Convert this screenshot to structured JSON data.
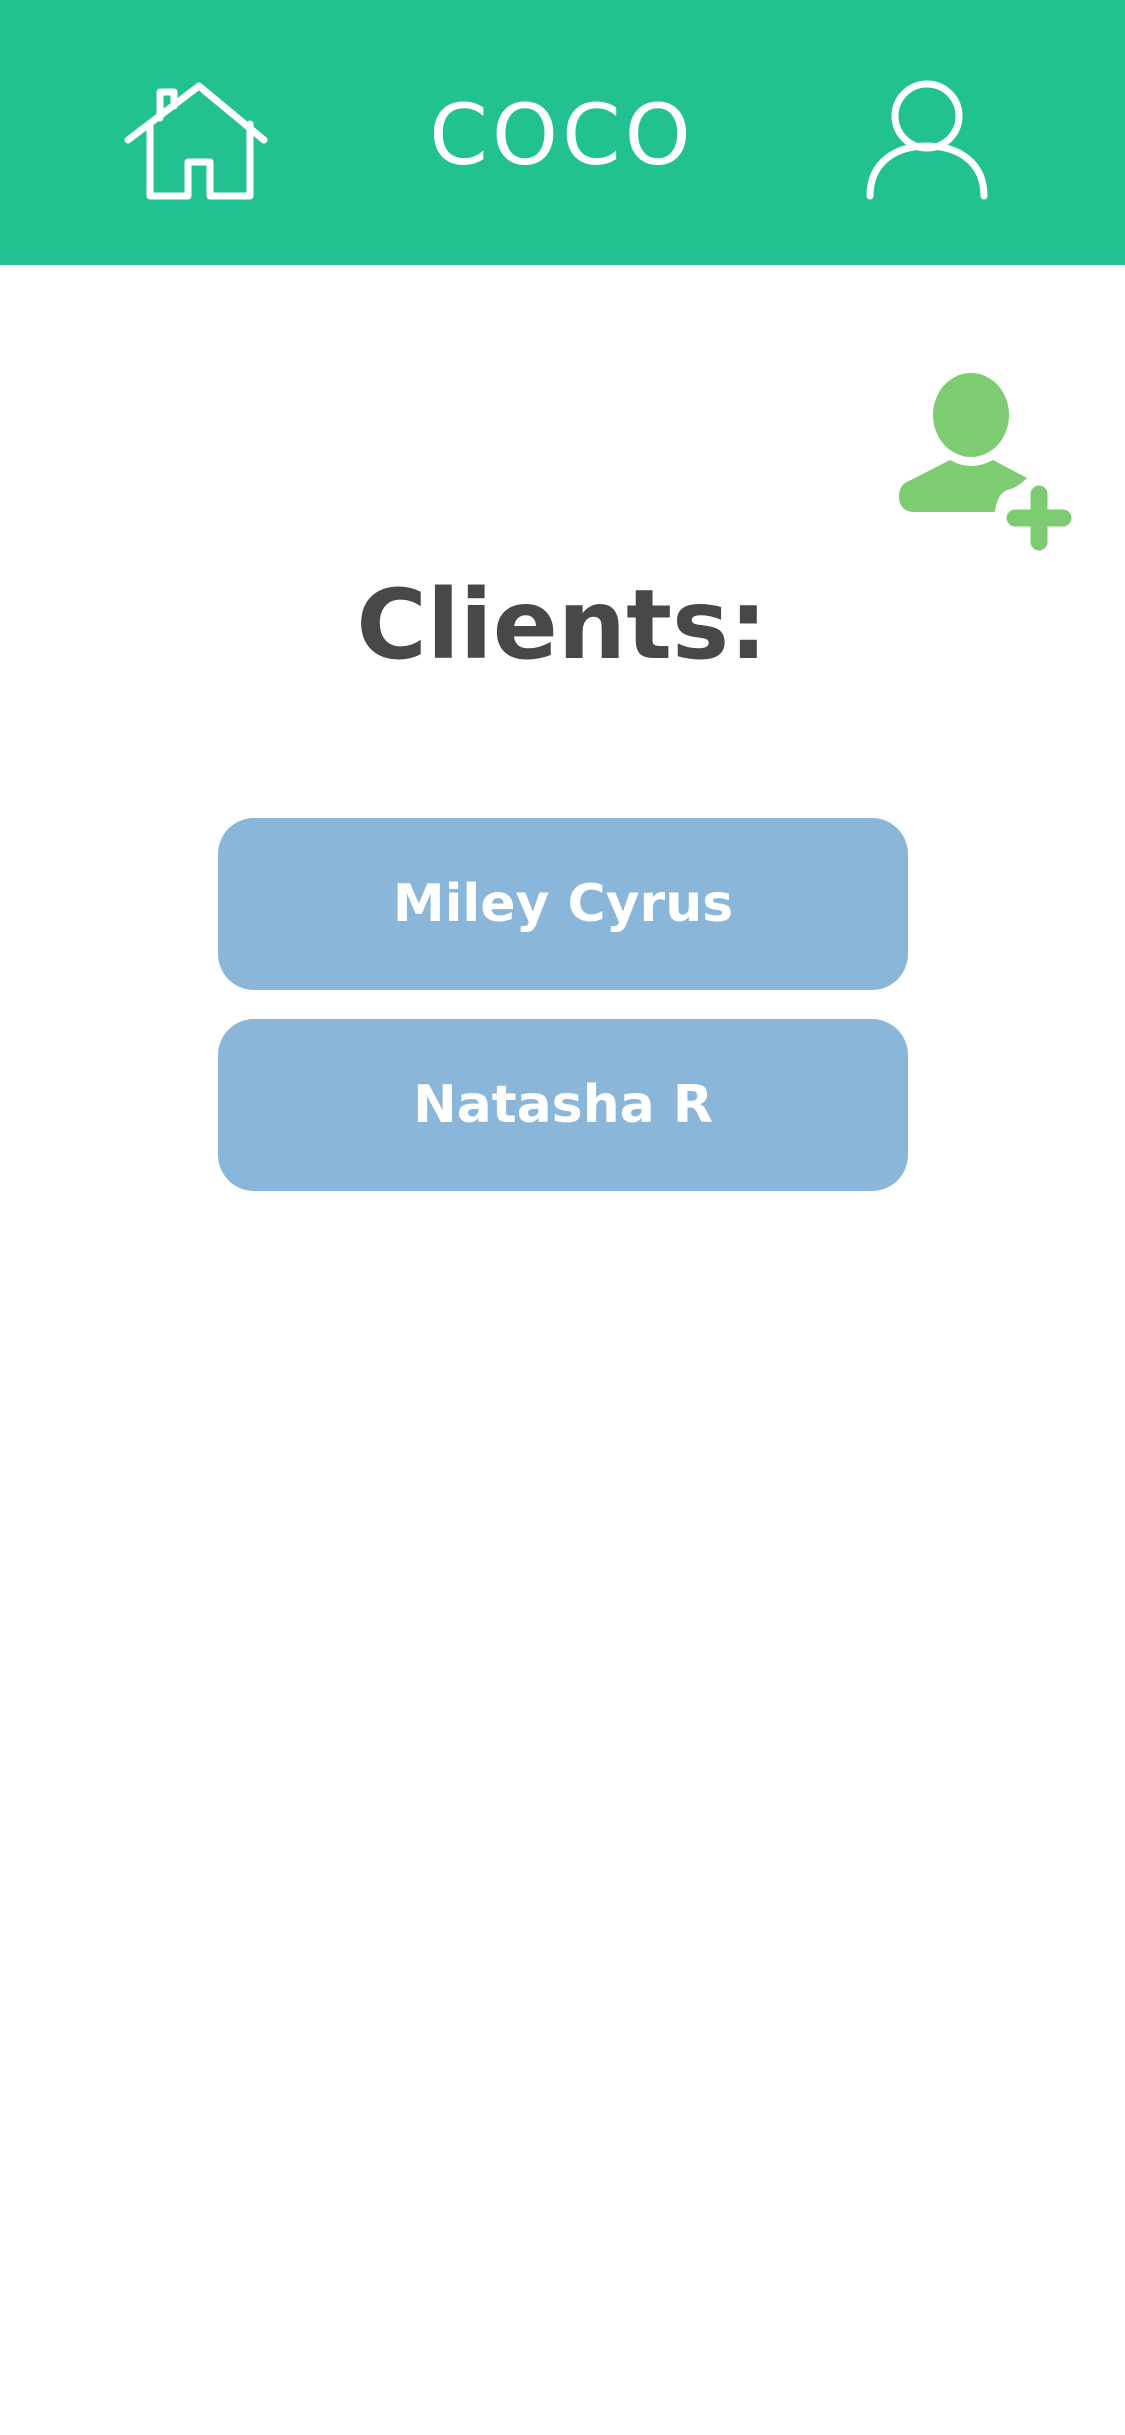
{
  "header": {
    "title": "COCO",
    "home_icon": "home-icon",
    "profile_icon": "user-profile-icon",
    "background_color": "#21c191"
  },
  "add_client": {
    "icon": "add-user-icon",
    "color": "#7dcc72"
  },
  "main": {
    "title": "Clients:",
    "clients": [
      {
        "name": "Miley Cyrus"
      },
      {
        "name": "Natasha R"
      }
    ],
    "client_button_color": "#8ab6d9"
  }
}
